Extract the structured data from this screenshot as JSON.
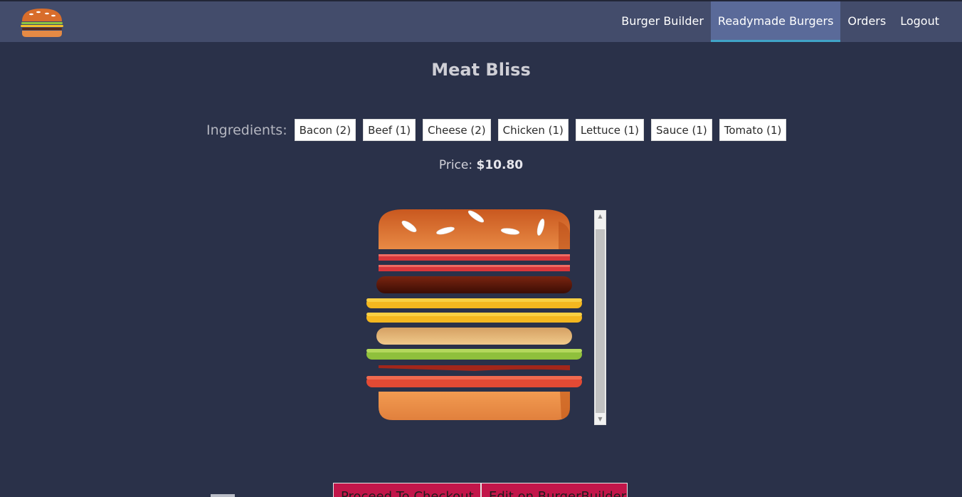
{
  "nav": {
    "items": [
      {
        "label": "Burger Builder",
        "active": false
      },
      {
        "label": "Readymade Burgers",
        "active": true
      },
      {
        "label": "Orders",
        "active": false
      },
      {
        "label": "Logout",
        "active": false
      }
    ],
    "logo_icon": "burger-logo-icon"
  },
  "burger": {
    "name": "Meat Bliss",
    "ingredients_label": "Ingredients:",
    "ingredients": [
      "Bacon (2)",
      "Beef (1)",
      "Cheese (2)",
      "Chicken (1)",
      "Lettuce (1)",
      "Sauce (1)",
      "Tomato (1)"
    ],
    "price_label": "Price:",
    "price_value": "$10.80"
  },
  "actions": {
    "checkout_label": "Proceed To Checkout",
    "edit_label": "Edit on BurgerBuilder"
  },
  "colors": {
    "background": "#2a3149",
    "topbar": "#434c6b",
    "active_nav": "#5a6a99",
    "active_underline": "#40a4c8",
    "action_button": "#c2164a"
  }
}
